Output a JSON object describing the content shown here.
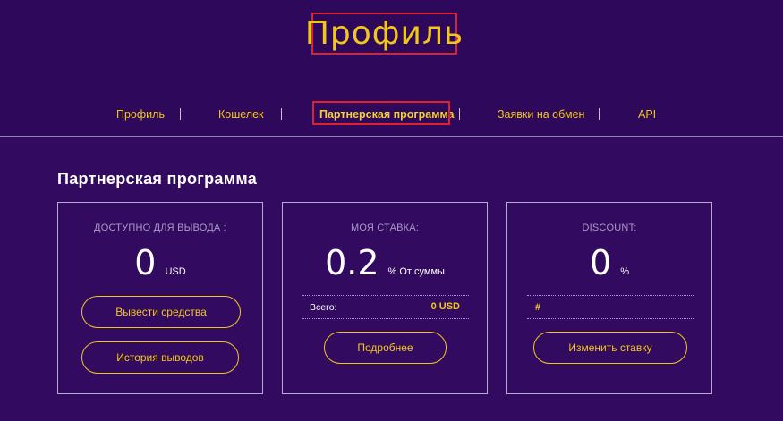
{
  "header": {
    "title": "Профиль"
  },
  "nav": {
    "items": [
      {
        "label": "Профиль"
      },
      {
        "label": "Кошелек"
      },
      {
        "label": "Партнерская программа"
      },
      {
        "label": "Заявки на обмен"
      },
      {
        "label": "API"
      }
    ],
    "active_index": 2
  },
  "section": {
    "title": "Партнерская программа"
  },
  "cards": {
    "available": {
      "label": "ДОСТУПНО ДЛЯ ВЫВОДА :",
      "value": "0",
      "unit": "USD",
      "withdraw_button": "Вывести средства",
      "history_button": "История выводов"
    },
    "rate": {
      "label": "МОЯ СТАВКА:",
      "value": "0.2",
      "unit": "% От суммы",
      "total_label": "Всего:",
      "total_value": "0 USD",
      "details_button": "Подробнее"
    },
    "discount": {
      "label": "DISCOUNT:",
      "value": "0",
      "unit": "%",
      "hash": "#",
      "change_button": "Изменить ставку"
    }
  },
  "colors": {
    "background": "#320a5f",
    "accent": "#f2c71b",
    "highlight_border": "#e0202a"
  }
}
